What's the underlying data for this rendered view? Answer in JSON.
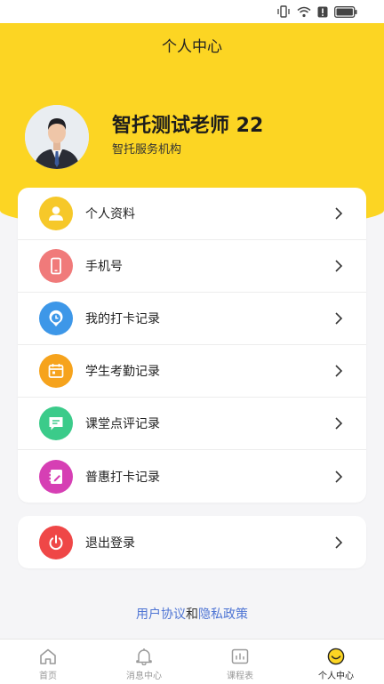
{
  "header": {
    "title": "个人中心"
  },
  "profile": {
    "name": "智托测试老师 22",
    "org": "智托服务机构"
  },
  "menu": [
    {
      "label": "个人资料",
      "icon": "profile-icon",
      "color": "#f6c829"
    },
    {
      "label": "手机号",
      "icon": "phone-icon",
      "color": "#f07a7a"
    },
    {
      "label": "我的打卡记录",
      "icon": "clock-pin-icon",
      "color": "#3d97e8"
    },
    {
      "label": "学生考勤记录",
      "icon": "calendar-icon",
      "color": "#f6a31c"
    },
    {
      "label": "课堂点评记录",
      "icon": "comment-icon",
      "color": "#3bcb8a"
    },
    {
      "label": "普惠打卡记录",
      "icon": "notebook-icon",
      "color": "#d63fb4"
    }
  ],
  "logout": {
    "label": "退出登录",
    "icon": "power-icon",
    "color": "#ef4747"
  },
  "policy": {
    "user_agreement": "用户协议",
    "and": "和",
    "privacy_policy": "隐私政策"
  },
  "tabs": [
    {
      "label": "首页",
      "icon": "home-icon",
      "active": false
    },
    {
      "label": "消息中心",
      "icon": "bell-icon",
      "active": false
    },
    {
      "label": "课程表",
      "icon": "schedule-icon",
      "active": false
    },
    {
      "label": "个人中心",
      "icon": "smiley-icon",
      "active": true
    }
  ],
  "colors": {
    "brand": "#fcd523",
    "link": "#4f75d4"
  }
}
